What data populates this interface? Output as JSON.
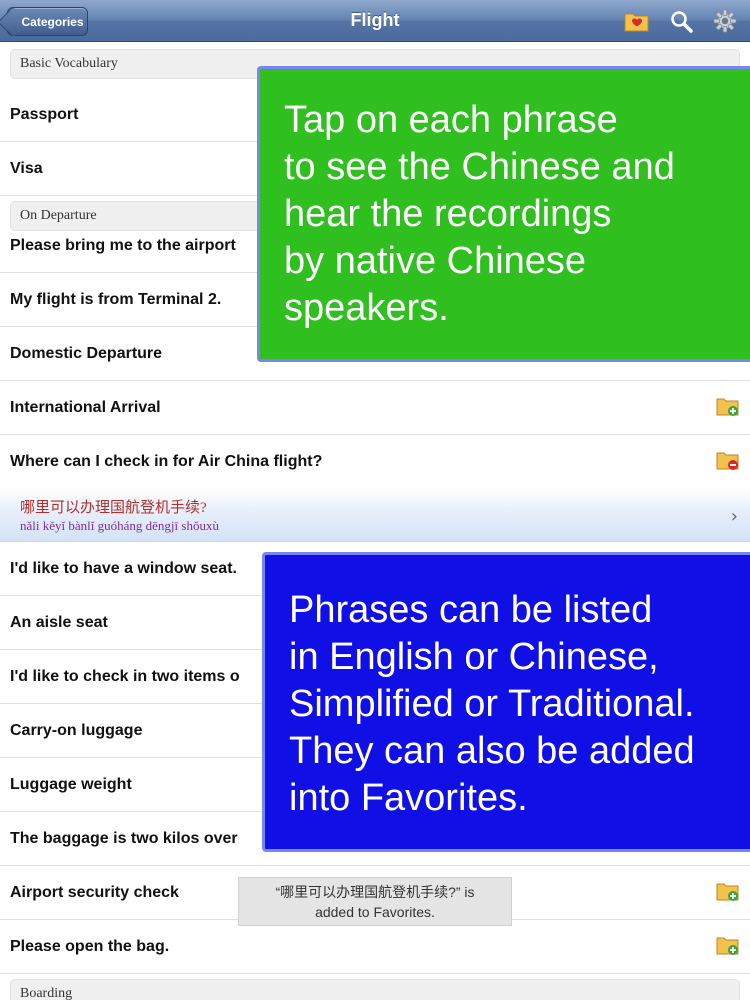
{
  "navbar": {
    "back_label": "Categories",
    "title": "Flight",
    "icons": [
      "favorites-folder-icon",
      "search-icon",
      "gear-icon"
    ]
  },
  "sections": {
    "basic": "Basic Vocabulary",
    "departure": "On Departure",
    "boarding": "Boarding"
  },
  "rows": [
    {
      "label": "Passport"
    },
    {
      "label": "Visa"
    },
    {
      "label": "Please bring me to the airport"
    },
    {
      "label": "My flight is from Terminal 2."
    },
    {
      "label": "Domestic Departure"
    },
    {
      "label": "International Arrival",
      "folder": "add"
    },
    {
      "label": "Where can I check in for Air China flight?",
      "folder": "remove"
    },
    {
      "label": "I'd like to have a window seat."
    },
    {
      "label": "An aisle seat"
    },
    {
      "label": "I'd like to check in two items o"
    },
    {
      "label": "Carry-on luggage"
    },
    {
      "label": "Luggage weight"
    },
    {
      "label": "The baggage is two kilos over"
    },
    {
      "label": "Airport security check",
      "folder": "add"
    },
    {
      "label": "Please open the bag.",
      "folder": "add"
    }
  ],
  "selected": {
    "chinese": "哪里可以办理国航登机手续?",
    "pinyin": "nǎli kěyǐ bànlǐ guóháng dēngjī shǒuxù"
  },
  "overlay_green": {
    "lines": [
      "Tap on each phrase",
      "to see the Chinese and",
      "hear the recordings",
      "by native Chinese",
      "speakers."
    ],
    "color": "#2fbf1f"
  },
  "overlay_blue": {
    "lines": [
      "Phrases can be listed",
      "in English or Chinese,",
      "Simplified or Traditional.",
      "They can also be added",
      "into Favorites."
    ],
    "color": "#1010e6"
  },
  "toast": {
    "line1": "“哪里可以办理国航登机手续?” is",
    "line2": "added to Favorites."
  },
  "colors": {
    "navbar": "#6584b3",
    "chinese_text": "#b0302a",
    "pinyin_text": "#7a2d9c"
  }
}
